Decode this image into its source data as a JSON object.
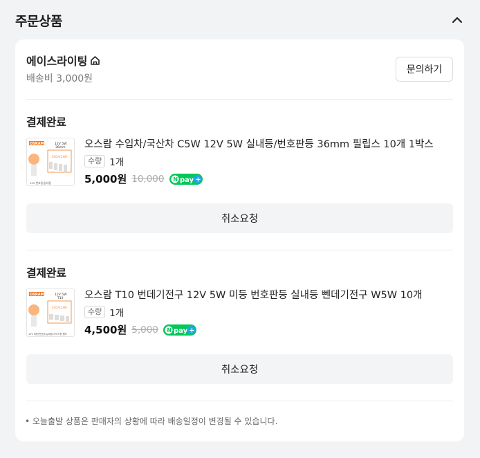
{
  "section": {
    "title": "주문상품"
  },
  "seller": {
    "name": "에이스라이팅",
    "shipping": "배송비 3,000원",
    "inquiry_label": "문의하기"
  },
  "orders": [
    {
      "status": "결제완료",
      "product_name": "오스람 수입차/국산차 C5W 12V 5W 실내등/번호판등 36mm 필립스 10개 1박스",
      "qty_label": "수량",
      "qty": "1개",
      "price": "5,000원",
      "original_price": "10,000",
      "cancel_label": "취소요청",
      "thumb": {
        "brand": "OSRAM",
        "spec": "12V 5W",
        "size": "36mm",
        "count": "X10개 1세트",
        "caption": "12V 번호등/실내등"
      }
    },
    {
      "status": "결제완료",
      "product_name": "오스람 T10 번데기전구 12V 5W 미등 번호판등 실내등 뻰데기전구 W5W 10개",
      "qty_label": "수량",
      "qty": "1개",
      "price": "4,500원",
      "original_price": "5,000",
      "cancel_label": "취소요청",
      "thumb": {
        "brand": "OSRAM",
        "spec": "12V 5W",
        "size": "T10",
        "count": "X10개 1세트",
        "caption": "12V 미등/번호등/실내등/사이드등 램프"
      }
    }
  ],
  "npay": {
    "label": "pay",
    "n": "N",
    "plus": "+"
  },
  "notice": "• 오늘출발 상품은 판매자의 상황에 따라 배송일정이 변경될 수 있습니다.",
  "colors": {
    "npay_green": "#03c75a",
    "npay_blue": "#1ea7e1",
    "osram_orange": "#f47a20"
  }
}
